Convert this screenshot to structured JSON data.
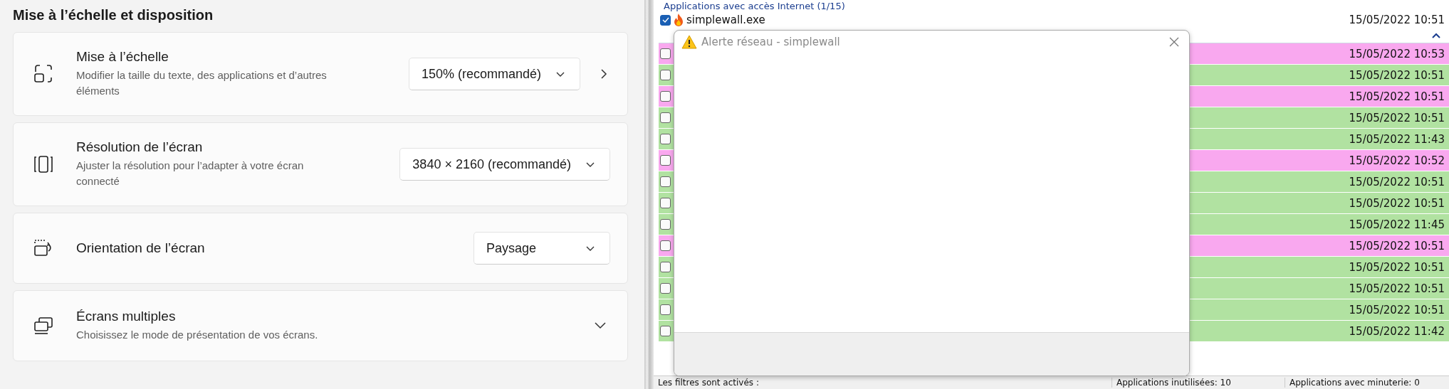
{
  "settings": {
    "section_title": "Mise à l’échelle et disposition",
    "cards": [
      {
        "kind": "dropdown-link",
        "title": "Mise à l’échelle",
        "description": "Modifier la taille du texte, des applications et d’autres éléments",
        "value": "150% (recommandé)"
      },
      {
        "kind": "dropdown",
        "title": "Résolution de l’écran",
        "description": "Ajuster la résolution pour l’adapter à  votre écran connecté",
        "value": "3840 × 2160 (recommandé)"
      },
      {
        "kind": "dropdown",
        "title": "Orientation de l’écran",
        "value": "Paysage"
      },
      {
        "kind": "expander",
        "title": "Écrans multiples",
        "description": "Choisissez le mode de présentation de vos écrans.",
        "expanded": false
      }
    ]
  },
  "app_list": {
    "group_title": "Applications avec accès Internet (1/15)",
    "top_row": {
      "name": "simplewall.exe",
      "checked": true,
      "date": "15/05/2022 10:51"
    },
    "rows": [
      {
        "checked": false,
        "color": "#f9a8ef",
        "date": "15/05/2022 10:53"
      },
      {
        "checked": false,
        "color": "#b1e2a1",
        "date": "15/05/2022 10:51"
      },
      {
        "checked": false,
        "color": "#f9a8ef",
        "date": "15/05/2022 10:51"
      },
      {
        "checked": false,
        "color": "#b1e2a1",
        "date": "15/05/2022 10:51"
      },
      {
        "checked": false,
        "color": "#b1e2a1",
        "date": "15/05/2022 11:43"
      },
      {
        "checked": false,
        "color": "#f9a8ef",
        "date": "15/05/2022 10:52"
      },
      {
        "checked": false,
        "color": "#b1e2a1",
        "date": "15/05/2022 10:51"
      },
      {
        "checked": false,
        "color": "#b1e2a1",
        "date": "15/05/2022 10:51"
      },
      {
        "checked": false,
        "color": "#b1e2a1",
        "date": "15/05/2022 11:45"
      },
      {
        "checked": false,
        "color": "#f9a8ef",
        "date": "15/05/2022 10:51"
      },
      {
        "checked": false,
        "color": "#b1e2a1",
        "date": "15/05/2022 10:51"
      },
      {
        "checked": false,
        "color": "#b1e2a1",
        "date": "15/05/2022 10:51"
      },
      {
        "checked": false,
        "color": "#b1e2a1",
        "date": "15/05/2022 10:51"
      },
      {
        "checked": false,
        "color": "#b1e2a1",
        "date": "15/05/2022 11:42"
      }
    ]
  },
  "status_bar": [
    "Les filtres sont activés :",
    "Applications inutilisées: 10",
    "Applications avec minuterie: 0"
  ],
  "dialog": {
    "title": "Alerte réseau - simplewall"
  }
}
